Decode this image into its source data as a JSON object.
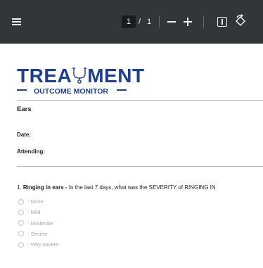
{
  "toolbar": {
    "page_current": "1",
    "page_separator": "/",
    "page_total": "1"
  },
  "icons": {
    "menu": "menu-icon",
    "zoom_out": "minus-icon",
    "zoom_in": "plus-icon",
    "fit_page": "fit-page-icon",
    "rotate": "rotate-icon",
    "logo": "stethoscope-icon"
  },
  "document": {
    "logo_title_left": "TREA",
    "logo_title_right": "MENT",
    "logo_subtitle": "OUTCOME MONITOR",
    "section": "Ears",
    "date_label": "Date:",
    "attending_label": "Attending:",
    "question": {
      "number": "1.",
      "title": "Ringing in ears -",
      "text": "In the last 7 days, what was the SEVERITY of RINGING IN"
    },
    "options": [
      {
        "label": "- None"
      },
      {
        "label": "- Mild"
      },
      {
        "label": "- Moderate"
      },
      {
        "label": "- Severe"
      },
      {
        "label": "- Very severe"
      }
    ]
  },
  "colors": {
    "toolbar_bg": "#323639",
    "brand_blue": "#1f3f86",
    "option_text": "#a9a9a9"
  }
}
